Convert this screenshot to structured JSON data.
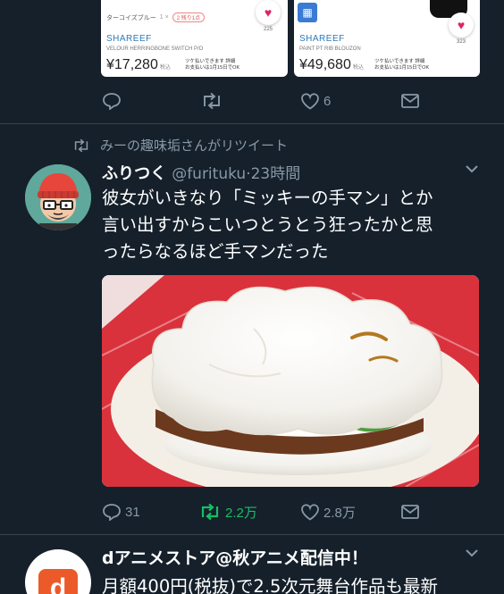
{
  "top_tweet": {
    "cards": [
      {
        "color_label": "ターコイズブルー",
        "qty": "1 ×",
        "stock_chip": "2 残り1点",
        "likes": "225",
        "brand": "SHAREEF",
        "product": "VELOUR HERRINGBONE SWITCH P/O",
        "price": "¥17,280",
        "tax": "税込",
        "note_line1": "ツケ払いできます 詳細",
        "note_line2": "お支払いは1月15日でOK"
      },
      {
        "likes": "323",
        "brand": "SHAREEF",
        "product": "PAINT PT RIB BLOUZON",
        "price": "¥49,680",
        "tax": "税込",
        "note_line1": "ツケ払いできます 詳細",
        "note_line2": "お支払いは1月15日でOK"
      }
    ],
    "actions": {
      "replies": "",
      "retweets": "",
      "likes": "6"
    }
  },
  "main_tweet": {
    "retweet_context": "みーの趣味垢さんがリツイート",
    "display_name": "ふりつく",
    "handle": "@furituku",
    "dot": "·",
    "time": "23時間",
    "text_lines": [
      "彼女がいきなり「ミッキーの手マン」とか",
      "言い出すからこいつとうとう狂ったかと思",
      "ったらなるほど手マンだった"
    ],
    "actions": {
      "replies": "31",
      "retweets": "2.2万",
      "likes": "2.8万"
    },
    "colors": {
      "retweeted": "#17bf63",
      "muted": "#8899a6"
    }
  },
  "next_tweet": {
    "display_name": "dアニメストア@秋アニメ配信中！",
    "text": "月額400円(税抜)で2.5次元舞台作品も最新",
    "avatar_letter": "d"
  }
}
